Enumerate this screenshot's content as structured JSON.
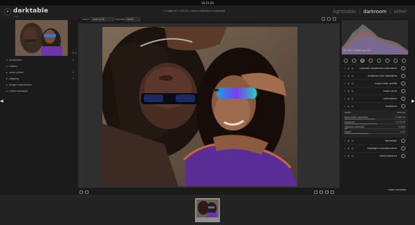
{
  "system": {
    "clock": "16:15:20"
  },
  "header": {
    "app_name": "darktable",
    "version": "3.4.1",
    "views": [
      "lighttable",
      "darkroom",
      "other"
    ],
    "active_view": "darkroom",
    "separator": "|"
  },
  "left_panel": {
    "modules": [
      {
        "label": "snapshots",
        "count": "0"
      },
      {
        "label": "history",
        "count": ""
      },
      {
        "label": "color picker",
        "count": "0"
      },
      {
        "label": "tagging",
        "count": "0"
      },
      {
        "label": "image information",
        "count": ""
      },
      {
        "label": "mask manager",
        "count": ""
      }
    ]
  },
  "center": {
    "filename": "1 image of 1 (#1) in current collection is selected",
    "zoom_label": "zoom",
    "zoom_value": "scale to fit",
    "overlay_label": "overlays",
    "overlay_value": "thirds"
  },
  "right_panel": {
    "histogram_info": "1/1 f/4.0 53mm iso 170",
    "modules": [
      {
        "name": "contrast brightness saturation"
      },
      {
        "name": "shadows and highlights"
      },
      {
        "name": "input color profile"
      },
      {
        "name": "base curve"
      },
      {
        "name": "orientation"
      },
      {
        "name": "exposure"
      },
      {
        "name": "demosaic"
      },
      {
        "name": "highlight reconstruction"
      },
      {
        "name": "white balance"
      }
    ],
    "exposure_sliders": [
      {
        "label": "mode",
        "value": "manual",
        "fill": 0
      },
      {
        "label": "black level correction",
        "value": "-0.000 EV",
        "fill": 0.5
      },
      {
        "label": "exposure",
        "value": "+0.70 EV",
        "fill": 0.55
      },
      {
        "label": "clipping threshold",
        "value": "0.00%",
        "fill": 0.05
      },
      {
        "label": "target",
        "value": "-4 EV",
        "fill": 0.4
      }
    ],
    "more_modules": "more modules"
  },
  "colors": {
    "background": "#1b1b1b",
    "panel": "#1f1f1f",
    "active_text": "#e2e2e2"
  }
}
